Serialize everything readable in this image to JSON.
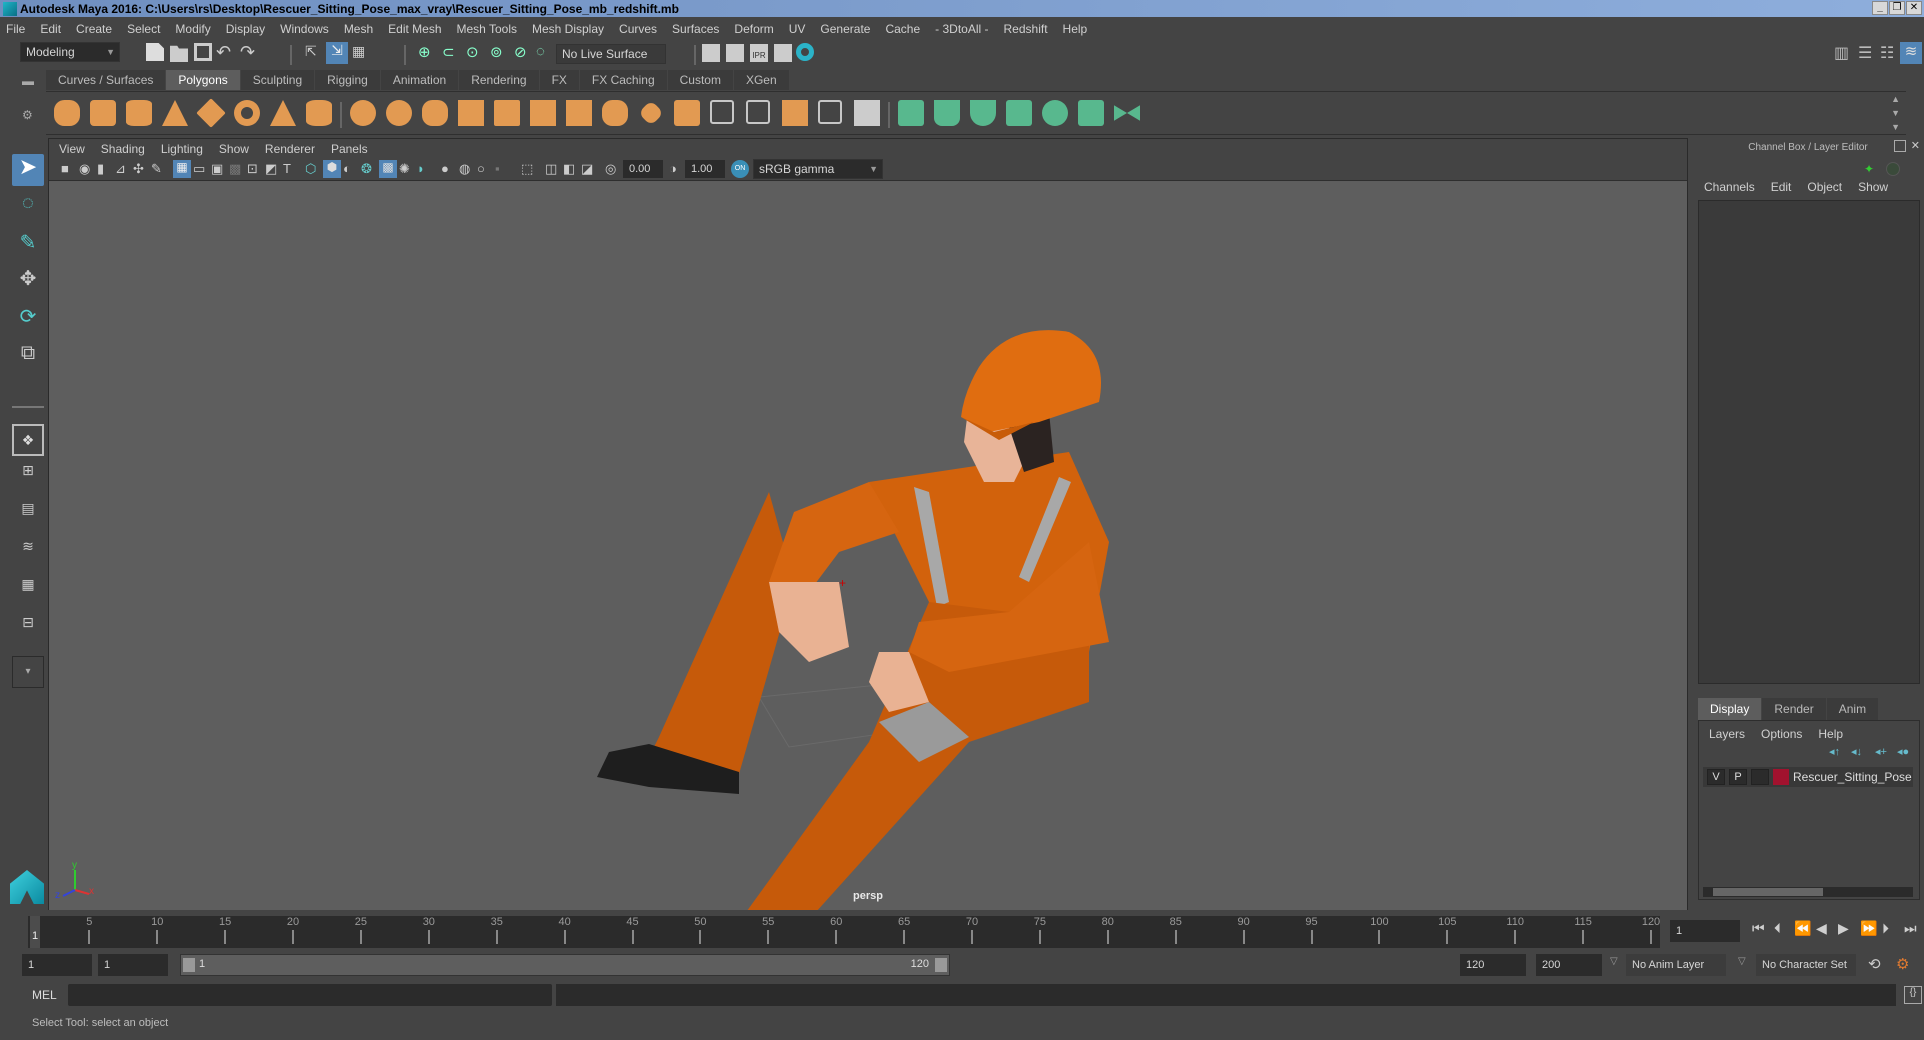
{
  "window": {
    "title": "Autodesk Maya 2016: C:\\Users\\rs\\Desktop\\Rescuer_Sitting_Pose_max_vray\\Rescuer_Sitting_Pose_mb_redshift.mb",
    "buttons": {
      "minimize": "_",
      "restore": "❐",
      "close": "✕"
    }
  },
  "menubar": [
    "File",
    "Edit",
    "Create",
    "Select",
    "Modify",
    "Display",
    "Windows",
    "Mesh",
    "Edit Mesh",
    "Mesh Tools",
    "Mesh Display",
    "Curves",
    "Surfaces",
    "Deform",
    "UV",
    "Generate",
    "Cache",
    "- 3DtoAll -",
    "Redshift",
    "Help"
  ],
  "statusline": {
    "mode": "Modeling",
    "live_surface": "No Live Surface",
    "ipr_label": "IPR"
  },
  "shelf": {
    "tabs": [
      "Curves / Surfaces",
      "Polygons",
      "Sculpting",
      "Rigging",
      "Animation",
      "Rendering",
      "FX",
      "FX Caching",
      "Custom",
      "XGen"
    ],
    "active_tab": "Polygons",
    "accent_color": "#e29a52",
    "uv_color": "#58b88e"
  },
  "viewport": {
    "menu": [
      "View",
      "Shading",
      "Lighting",
      "Show",
      "Renderer",
      "Panels"
    ],
    "exposure": "0.00",
    "gamma": "1.00",
    "color_space": "sRGB gamma",
    "camera_label": "persp",
    "axis": {
      "x": "x",
      "y": "y",
      "z": "z"
    }
  },
  "channel_box": {
    "title": "Channel Box / Layer Editor",
    "menu": [
      "Channels",
      "Edit",
      "Object",
      "Show"
    ]
  },
  "layer_editor": {
    "tabs": [
      "Display",
      "Render",
      "Anim"
    ],
    "active_tab": "Display",
    "menu": [
      "Layers",
      "Options",
      "Help"
    ],
    "layers": [
      {
        "visible": "V",
        "playback": "P",
        "name": "Rescuer_Sitting_Pose",
        "color": "#a1122e"
      }
    ]
  },
  "timeline": {
    "ticks": [
      5,
      10,
      15,
      20,
      25,
      30,
      35,
      40,
      45,
      50,
      55,
      60,
      65,
      70,
      75,
      80,
      85,
      90,
      95,
      100,
      105,
      110,
      115,
      120
    ],
    "current_frame_marker": "1",
    "current_frame": "1",
    "range_start": "1",
    "playback_start": "1",
    "range_slider_start": "1",
    "range_slider_end": "120",
    "playback_end": "120",
    "range_end": "200",
    "anim_layer": "No Anim Layer",
    "character_set": "No Character Set"
  },
  "command_line": {
    "language": "MEL",
    "value": ""
  },
  "help_line": "Select Tool: select an object"
}
